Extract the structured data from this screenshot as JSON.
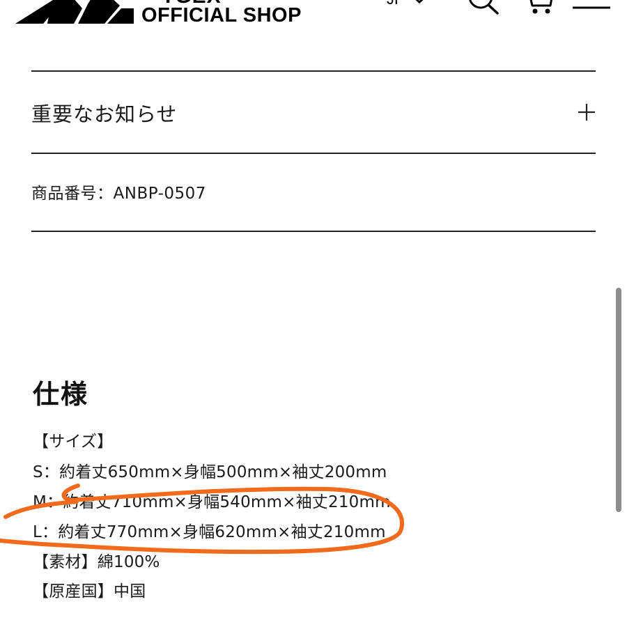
{
  "header": {
    "brand_top": "TGEX",
    "brand": "OFFICIAL SHOP",
    "language": "JP",
    "icons": [
      "logo-icon",
      "chevron-down-icon",
      "search-icon",
      "cart-icon",
      "menu-icon"
    ]
  },
  "notice": {
    "title": "重要なお知らせ",
    "toggle_icon": "plus-icon"
  },
  "product": {
    "number_line": "商品番号：ANBP-0507"
  },
  "specs": {
    "heading": "仕様",
    "size_header": "【サイズ】",
    "sizes": [
      "S：約着丈650mm×身幅500mm×袖丈200mm",
      "M：約着丈710mm×身幅540mm×袖丈210mm",
      "L：約着丈770mm×身幅620mm×袖丈210mm"
    ],
    "material": "【素材】綿100%",
    "origin": "【原産国】中国"
  },
  "colors": {
    "text": "#1a1a1a",
    "divider": "#222222",
    "annotation_stroke": "#f26a1b",
    "scrollbar": "#8c8c8c"
  }
}
